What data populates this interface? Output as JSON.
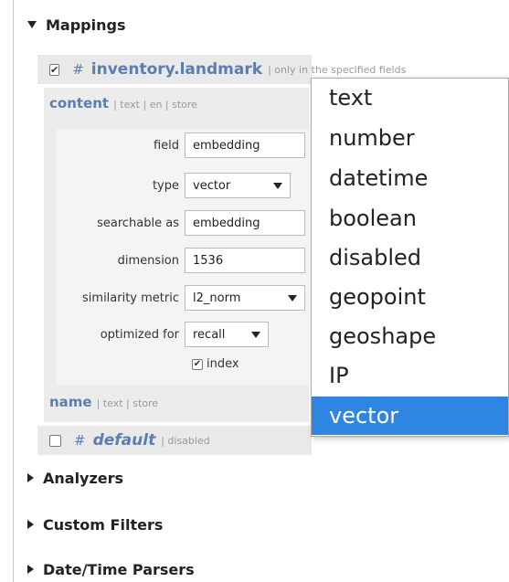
{
  "sections": {
    "mappings": "Mappings",
    "analyzers": "Analyzers",
    "custom_filters": "Custom Filters",
    "datetime_parsers": "Date/Time Parsers"
  },
  "index_inventory": {
    "checked_mark": "✔",
    "hash": "#",
    "name": "inventory.landmark",
    "meta": "| only in the specified fields"
  },
  "index_default": {
    "hash": "#",
    "name": "default",
    "meta": "| disabled"
  },
  "field_content": {
    "name": "content",
    "meta": "| text | en | store"
  },
  "field_name": {
    "name": "name",
    "meta": "| text | store"
  },
  "form": {
    "field_label": "field",
    "field_value": "embedding",
    "type_label": "type",
    "type_value": "vector",
    "searchable_label": "searchable as",
    "searchable_value": "embedding",
    "dimension_label": "dimension",
    "dimension_value": "1536",
    "similarity_label": "similarity metric",
    "similarity_value": "l2_norm",
    "optimized_label": "optimized for",
    "optimized_value": "recall",
    "index_checkbox_mark": "✔",
    "index_label": "index"
  },
  "type_dropdown": {
    "options": [
      "text",
      "number",
      "datetime",
      "boolean",
      "disabled",
      "geopoint",
      "geoshape",
      "IP",
      "vector"
    ],
    "selected": "vector",
    "highlight_color": "#2f86e2"
  },
  "colors": {
    "accent_link": "#5b7db1",
    "panel_bg": "#e9e9e9"
  }
}
